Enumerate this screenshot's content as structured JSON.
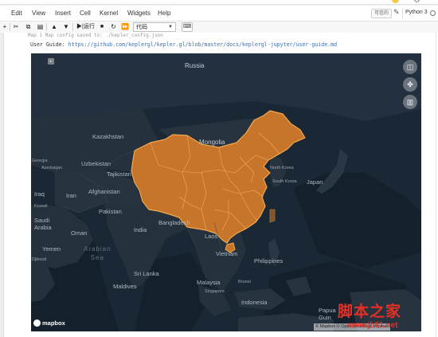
{
  "menu": {
    "items": [
      "Edit",
      "View",
      "Insert",
      "Cell",
      "Kernel",
      "Widgets",
      "Help"
    ],
    "trusted": "可信的",
    "kernel": "Python 3"
  },
  "toolbar": {
    "run_label": "运行",
    "cell_type": "代码"
  },
  "cell": {
    "truncated_line": "Map 1  Map config saved to: ./kepler_config.json",
    "guide_label": "User Guide:",
    "guide_url": "https://github.com/keplergl/kepler.gl/blob/master/docs/keplergl-jupyter/user-guide.md"
  },
  "map": {
    "highlight_color": "#c8752c",
    "border_color": "#f3a94e",
    "labels": {
      "russia": "Russia",
      "kazakhstan": "Kazakhstan",
      "mongolia": "Mongolia",
      "georgia": "Georgia",
      "azerbaijan": "Azerbaijan",
      "uzbekistan": "Uzbekistan",
      "tajikistan": "Tajikistan",
      "north_korea": "North Korea",
      "south_korea": "South Korea",
      "japan": "Japan",
      "iraq": "Iraq",
      "iran": "Iran",
      "afghanistan": "Afghanistan",
      "kuwait": "Kuwait",
      "pakistan": "Pakistan",
      "saudi_arabia": "Saudi\nArabia",
      "oman": "Oman",
      "india": "India",
      "bangladesh": "Bangladesh",
      "laos": "Laos",
      "yemen": "Yemen",
      "arabian_sea": "Arabian\nSea",
      "djibouti": "Djibouti",
      "vietnam": "Vietnam",
      "philippines": "Philippines",
      "sri_lanka": "Sri Lanka",
      "maldives": "Maldives",
      "malaysia": "Malaysia",
      "singapore": "Singapore",
      "brunei": "Brunei",
      "indonesia": "Indonesia",
      "papua": "Papua\nGuin"
    },
    "logo": "mapbox",
    "attribution": "© Mapbox © OpenStreetMap Improve"
  },
  "watermark": {
    "cn": "脚本之家",
    "url": "www.jb51.net"
  }
}
